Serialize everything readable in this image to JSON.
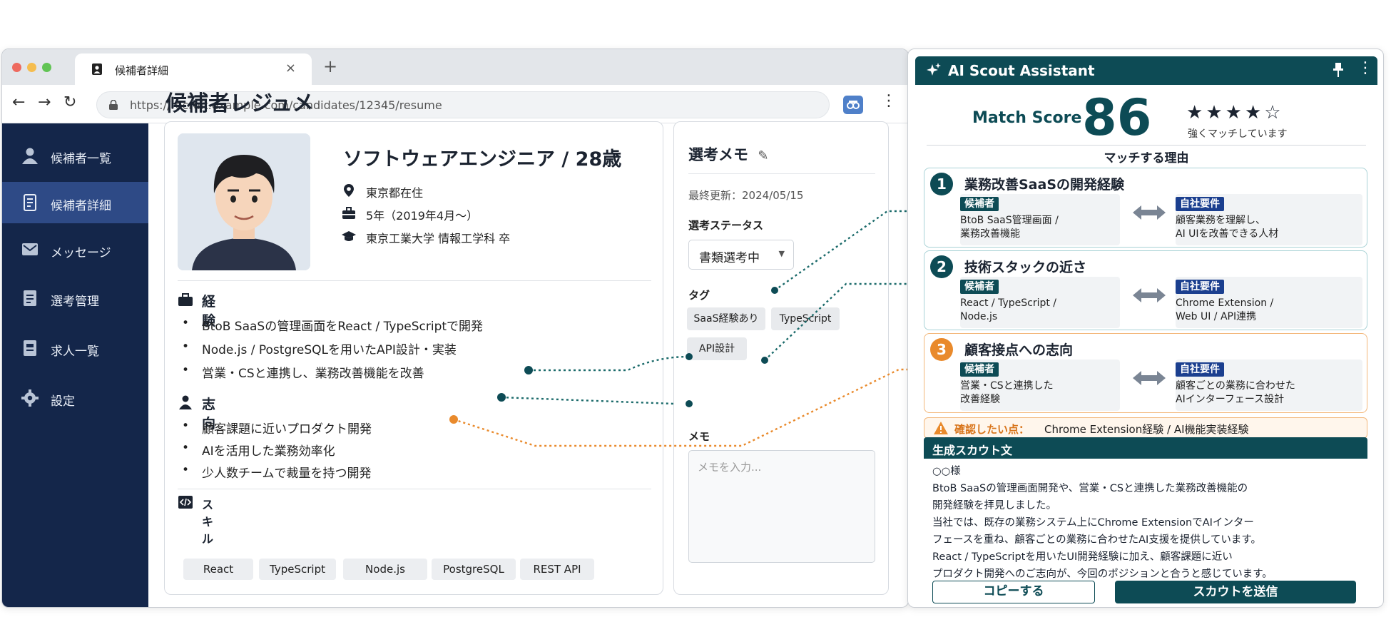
{
  "browser": {
    "tab_title": "候補者詳細",
    "tab_close": "×",
    "new_tab": "+",
    "url": "https://recruit.example.com/candidates/12345/resume"
  },
  "sidebar": {
    "items": [
      {
        "label": "候補者一覧",
        "icon": "person-icon"
      },
      {
        "label": "候補者詳細",
        "icon": "document-icon",
        "active": true
      },
      {
        "label": "メッセージ",
        "icon": "message-icon"
      },
      {
        "label": "選考管理",
        "icon": "clipboard-icon"
      },
      {
        "label": "求人一覧",
        "icon": "list-icon"
      },
      {
        "label": "設定",
        "icon": "gear-icon"
      }
    ]
  },
  "main": {
    "page_title": "候補者レジュメ",
    "profile": {
      "title": "ソフトウェアエンジニア / 28歳",
      "location": "東京都在住",
      "experience_years": "5年（2019年4月〜）",
      "education": "東京工業大学 情報工学科 卒"
    },
    "experience": {
      "heading": "経験",
      "items": [
        "BtoB SaaSの管理画面をReact / TypeScriptで開発",
        "Node.js / PostgreSQLを用いたAPI設計・実装",
        "営業・CSと連携し、業務改善機能を改善"
      ]
    },
    "aspiration": {
      "heading": "志向",
      "items": [
        "顧客課題に近いプロダクト開発",
        "AIを活用した業務効率化",
        "少人数チームで裁量を持つ開発"
      ]
    },
    "skills": {
      "heading": "スキル",
      "items": [
        "React",
        "TypeScript",
        "Node.js",
        "PostgreSQL",
        "REST API"
      ]
    }
  },
  "memo": {
    "title": "選考メモ",
    "last_updated": "最終更新：2024/05/15",
    "status_label": "選考ステータス",
    "status_value": "書類選考中",
    "tags_label": "タグ",
    "tags": [
      "SaaS経験あり",
      "TypeScript",
      "API設計"
    ],
    "memo_label": "メモ",
    "memo_placeholder": "メモを入力..."
  },
  "ai": {
    "title": "AI Scout Assistant",
    "match_score_label": "Match Score",
    "match_score": "86",
    "rating": 4,
    "rating_max": 5,
    "match_note": "強くマッチしています",
    "reasons_title": "マッチする理由",
    "reasons": [
      {
        "num": "1",
        "title": "業務改善SaaSの開発経験",
        "candidate_badge": "候補者",
        "candidate_text": "BtoB SaaS管理画面 /\n業務改善機能",
        "company_badge": "自社要件",
        "company_text": "顧客業務を理解し、\nAI UIを改善できる人材"
      },
      {
        "num": "2",
        "title": "技術スタックの近さ",
        "candidate_badge": "候補者",
        "candidate_text": "React / TypeScript /\nNode.js",
        "company_badge": "自社要件",
        "company_text": "Chrome Extension /\nWeb UI / API連携"
      },
      {
        "num": "3",
        "title": "顧客接点への志向",
        "candidate_badge": "候補者",
        "candidate_text": "営業・CSと連携した\n改善経験",
        "company_badge": "自社要件",
        "company_text": "顧客ごとの業務に合わせた\nAIインターフェース設計"
      }
    ],
    "confirm_label": "確認したい点：",
    "confirm_text": "Chrome Extension経験 / AI機能実装経験",
    "scout_heading": "生成スカウト文",
    "scout_lines": [
      "○○様",
      "BtoB SaaSの管理画面開発や、営業・CSと連携した業務改善機能の",
      "開発経験を拝見しました。",
      "当社では、既存の業務システム上にChrome ExtensionでAIインター",
      "フェースを重ね、顧客ごとの業務に合わせたAI支援を提供しています。",
      "React / TypeScriptを用いたUI開発経験に加え、顧客課題に近い",
      "プロダクト開発へのご志向が、今回のポジションと合うと感じています。"
    ],
    "copy_button": "コピーする",
    "send_button": "スカウトを送信"
  },
  "colors": {
    "sidebar_bg": "#14264a",
    "sidebar_active": "#2e4a86",
    "accent_teal": "#0d4b55",
    "accent_orange": "#e98a2c",
    "company_badge": "#1b3f8f"
  }
}
